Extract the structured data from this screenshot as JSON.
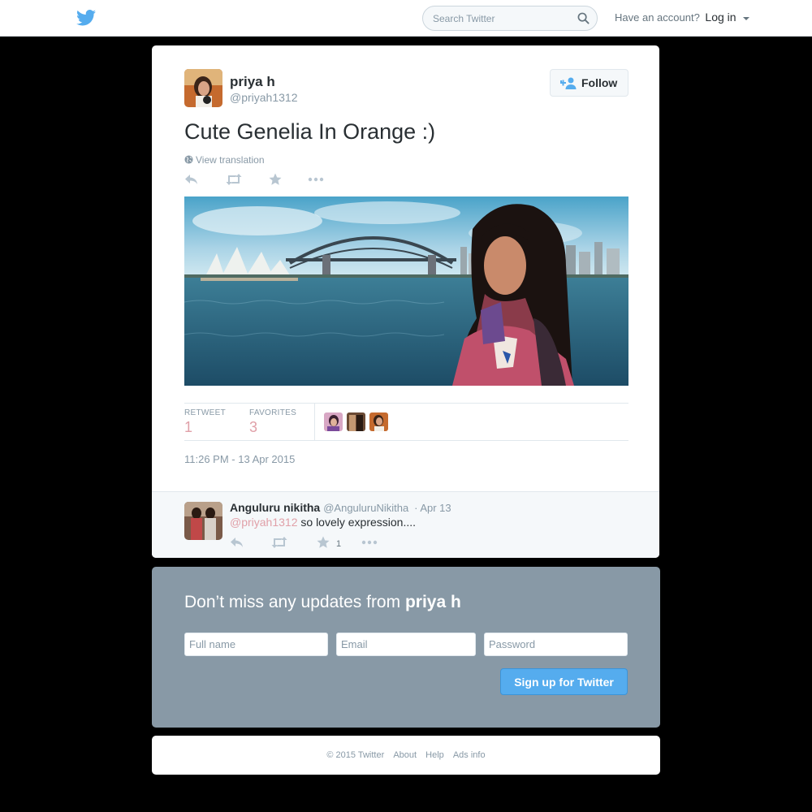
{
  "header": {
    "search_placeholder": "Search Twitter",
    "account_text": "Have an account?",
    "login_label": "Log in",
    "icons": [
      "twitter-bird-icon",
      "search-icon",
      "caret-down-icon"
    ]
  },
  "tweet": {
    "author_name": "priya h",
    "author_handle": "@priyah1312",
    "follow_label": "Follow",
    "text": "Cute Genelia In Orange :)",
    "view_translation": "View translation",
    "retweet_label": "RETWEET",
    "retweet_count": "1",
    "favorites_label": "FAVORITES",
    "favorites_count": "3",
    "timestamp": "11:26 PM - 13 Apr 2015"
  },
  "reply": {
    "name": "Anguluru nikitha",
    "handle": "@AnguluruNikitha",
    "date": "· Apr 13",
    "mention": "@priyah1312",
    "text": " so lovely expression....",
    "favorite_count": "1"
  },
  "signup": {
    "heading_prefix": "Don’t miss any updates from ",
    "heading_name": "priya h",
    "fullname_placeholder": "Full name",
    "email_placeholder": "Email",
    "password_placeholder": "Password",
    "button_label": "Sign up for Twitter"
  },
  "footer": {
    "copyright": "© 2015 Twitter",
    "about": "About",
    "help": "Help",
    "ads": "Ads info"
  },
  "colors": {
    "twitter_blue": "#55acee",
    "muted_gray": "#8899a6",
    "count_pink": "#e0a0a8",
    "signup_bg": "#8899a6"
  }
}
